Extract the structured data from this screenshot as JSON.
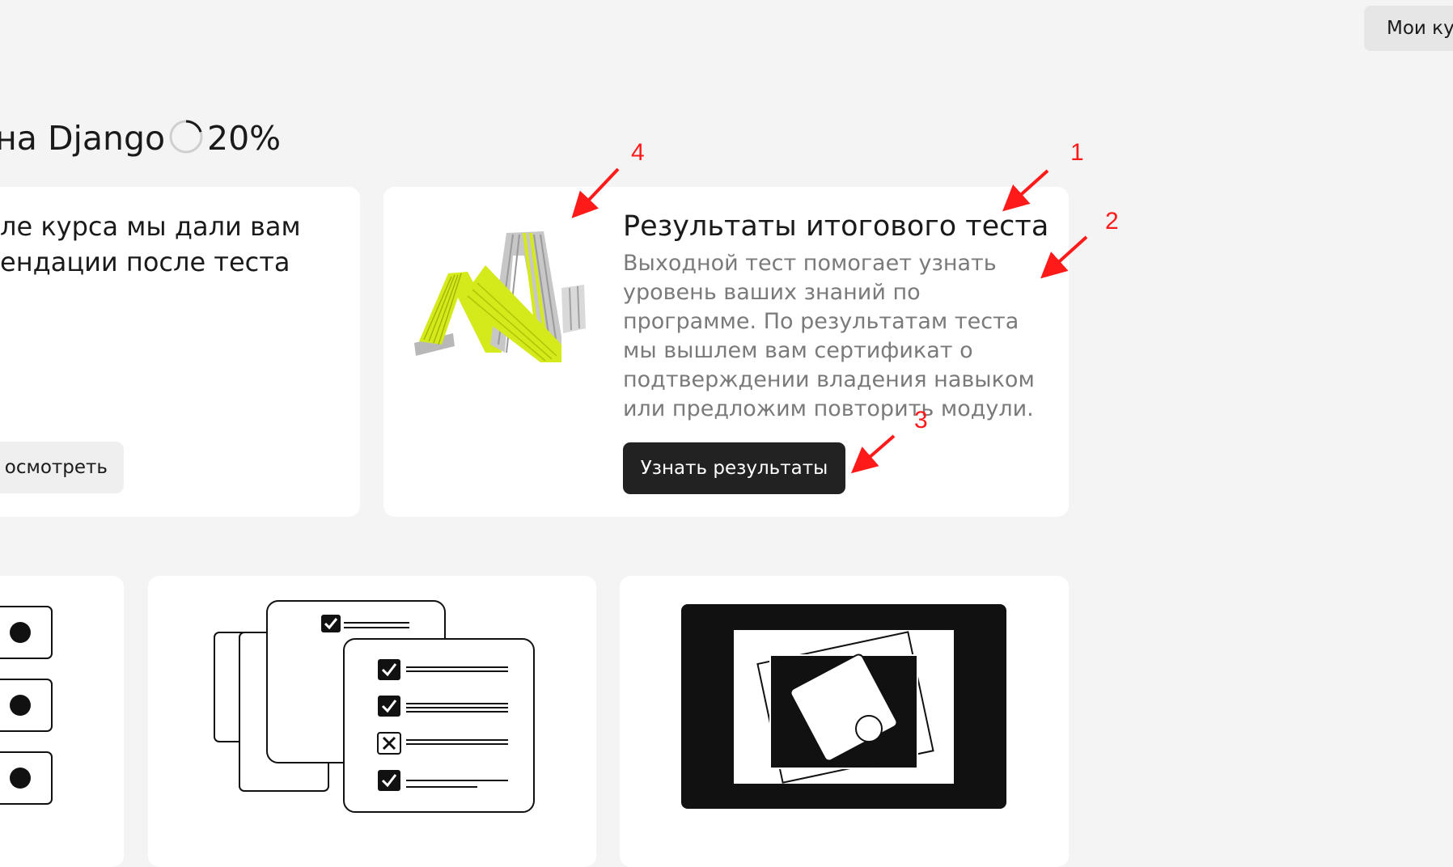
{
  "header": {
    "my_courses_label": "Мои ку"
  },
  "course": {
    "title": "на Django",
    "progress_text": "20%",
    "progress_fraction": 0.2
  },
  "card_left": {
    "text_line1": "ле курса мы дали вам",
    "text_line2": "ендации после теста",
    "button_label": "осмотреть"
  },
  "card_result": {
    "title": "Результаты итогового теста",
    "description": "Выходной тест помогает узнать уровень ваших знаний по программе. По результатам теста мы вышлем вам сертификат о подтверждении владения навыком или предложим повторить модули.",
    "button_label": "Узнать результаты"
  },
  "annotations": {
    "n1": "1",
    "n2": "2",
    "n3": "3",
    "n4": "4",
    "color": "#ff1a1a"
  },
  "colors": {
    "background": "#f4f4f4",
    "card": "#ffffff",
    "primary_button": "#222222",
    "secondary_button": "#efefef",
    "muted_text": "#7a7a7a",
    "accent_yellow": "#d4ea1a"
  }
}
